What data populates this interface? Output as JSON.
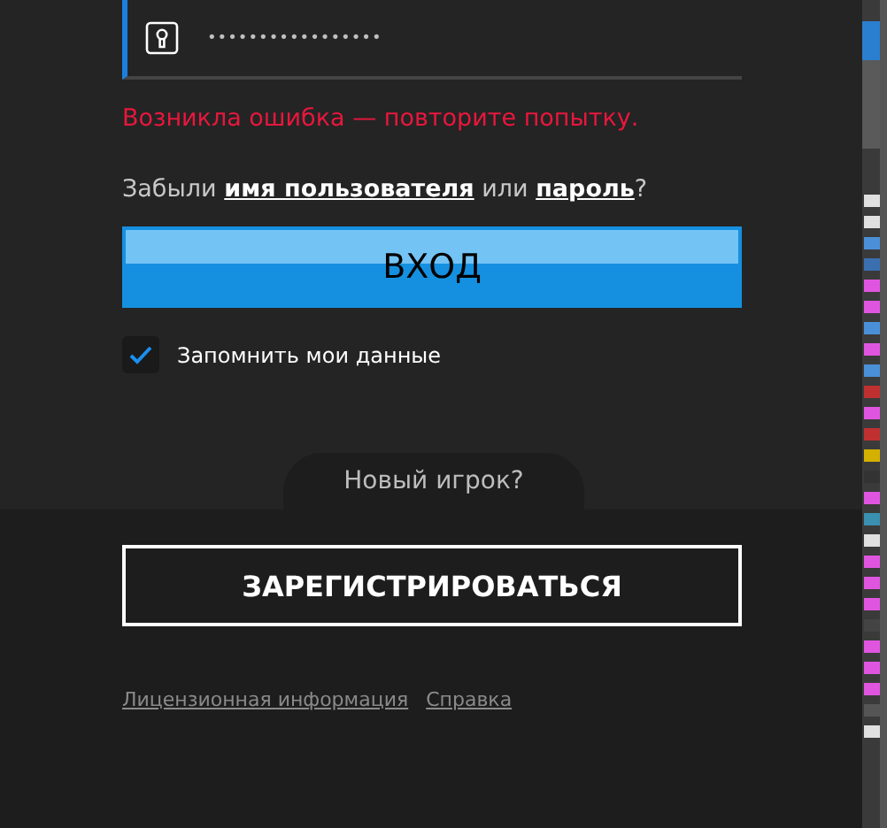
{
  "password_field": {
    "value": "•••••••••••••••••"
  },
  "error": "Возникла ошибка — повторите попытку.",
  "forgot": {
    "prefix": "Забыли",
    "username_link": "имя пользователя",
    "middle": "или",
    "password_link": "пароль",
    "suffix": "?"
  },
  "login_button": "ВХОД",
  "remember": {
    "label": "Запомнить мои данные",
    "checked": true
  },
  "new_player": "Новый игрок?",
  "register_button": "ЗАРЕГИСТРИРОВАТЬСЯ",
  "footer_links": [
    "Лицензионная информация",
    "Справка"
  ]
}
